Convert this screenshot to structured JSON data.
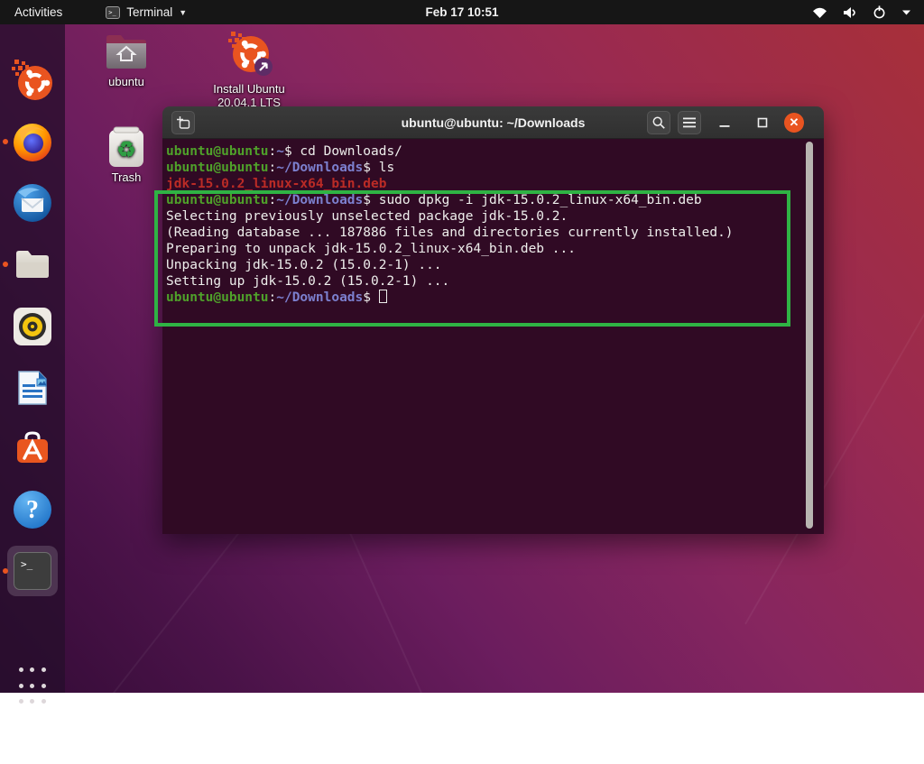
{
  "topbar": {
    "activities_label": "Activities",
    "app_menu_label": "Terminal",
    "clock": "Feb 17  10:51",
    "system_icons": [
      "wifi-icon",
      "volume-icon",
      "power-icon",
      "chevron-down-icon"
    ]
  },
  "desktop": {
    "home_label": "ubuntu",
    "installer_label_line1": "Install Ubuntu",
    "installer_label_line2": "20.04.1 LTS",
    "trash_label": "Trash"
  },
  "dock": {
    "items": [
      "ubuntu-logo",
      "firefox",
      "thunderbird",
      "files",
      "rhythmbox",
      "libreoffice-writer",
      "ubuntu-software",
      "help",
      "terminal",
      "show-applications"
    ],
    "running_indicators": [
      "firefox",
      "files",
      "terminal"
    ],
    "terminal_glyph": ">_"
  },
  "terminal": {
    "title": "ubuntu@ubuntu: ~/Downloads",
    "lines": [
      {
        "segments": [
          {
            "t": "ubuntu@ubuntu",
            "c": "user"
          },
          {
            "t": ":",
            "c": "fg"
          },
          {
            "t": "~",
            "c": "path"
          },
          {
            "t": "$ cd Downloads/",
            "c": "fg"
          }
        ]
      },
      {
        "segments": [
          {
            "t": "ubuntu@ubuntu",
            "c": "user"
          },
          {
            "t": ":",
            "c": "fg"
          },
          {
            "t": "~/Downloads",
            "c": "path"
          },
          {
            "t": "$ ls",
            "c": "fg"
          }
        ]
      },
      {
        "segments": [
          {
            "t": "jdk-15.0.2_linux-x64_bin.deb",
            "c": "file"
          }
        ]
      },
      {
        "segments": [
          {
            "t": "ubuntu@ubuntu",
            "c": "user"
          },
          {
            "t": ":",
            "c": "fg"
          },
          {
            "t": "~/Downloads",
            "c": "path"
          },
          {
            "t": "$ sudo dpkg -i jdk-15.0.2_linux-x64_bin.deb",
            "c": "fg"
          }
        ]
      },
      {
        "segments": [
          {
            "t": "Selecting previously unselected package jdk-15.0.2.",
            "c": "fg"
          }
        ]
      },
      {
        "segments": [
          {
            "t": "(Reading database ... 187886 files and directories currently installed.)",
            "c": "fg"
          }
        ]
      },
      {
        "segments": [
          {
            "t": "Preparing to unpack jdk-15.0.2_linux-x64_bin.deb ...",
            "c": "fg"
          }
        ]
      },
      {
        "segments": [
          {
            "t": "Unpacking jdk-15.0.2 (15.0.2-1) ...",
            "c": "fg"
          }
        ]
      },
      {
        "segments": [
          {
            "t": "Setting up jdk-15.0.2 (15.0.2-1) ...",
            "c": "fg"
          }
        ]
      },
      {
        "segments": [
          {
            "t": "ubuntu@ubuntu",
            "c": "user"
          },
          {
            "t": ":",
            "c": "fg"
          },
          {
            "t": "~/Downloads",
            "c": "path"
          },
          {
            "t": "$ ",
            "c": "fg"
          }
        ],
        "cursor": true
      }
    ]
  },
  "colors": {
    "terminal_background": "#300a24",
    "prompt_user_green": "#4fa12a",
    "prompt_path_blue": "#7c80cf",
    "ls_archive_red": "#bb2b26",
    "annotation_green": "#2fb344",
    "close_button_orange": "#e95420",
    "topbar_black": "#161616"
  }
}
